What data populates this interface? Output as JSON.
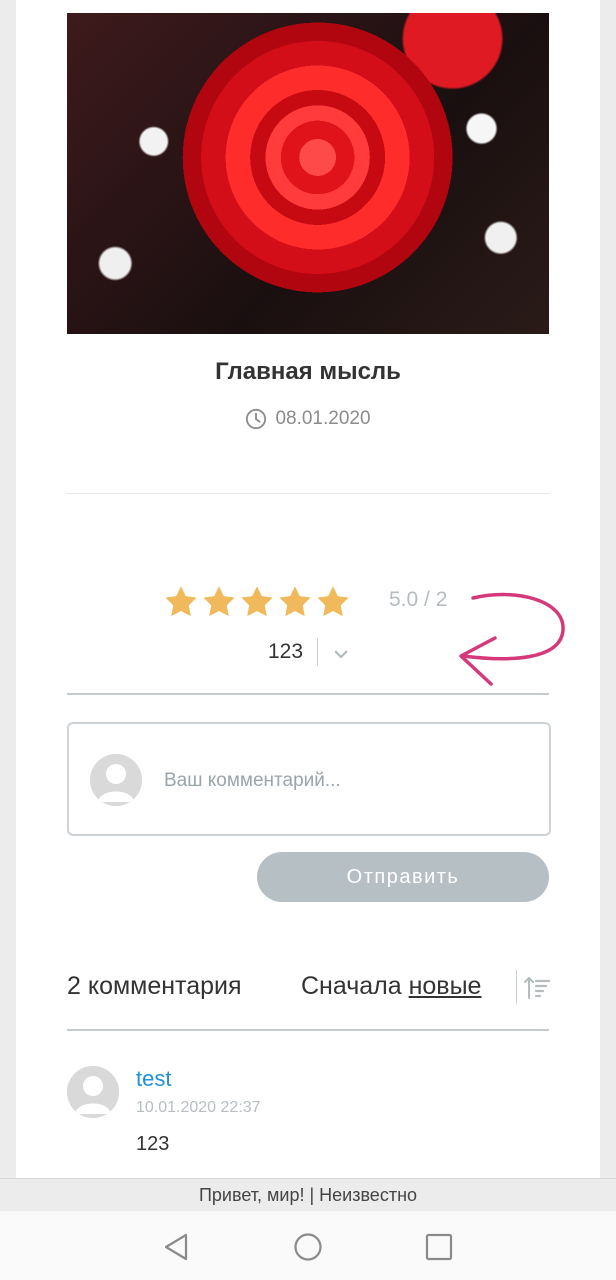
{
  "post": {
    "title": "Главная мысль",
    "date": "08.01.2020"
  },
  "rating": {
    "stars": 5,
    "max_stars": 5,
    "summary": "5.0 / 2",
    "vote_count": "123",
    "star_color": "#f0b95c"
  },
  "comment_form": {
    "placeholder": "Ваш комментарий...",
    "submit_label": "Отправить"
  },
  "comments_section": {
    "count_label": "2 комментария",
    "sort_prefix": "Сначала",
    "sort_link": "новые",
    "items": [
      {
        "author": "test",
        "time": "10.01.2020 22:37",
        "text": "123"
      }
    ]
  },
  "footer": {
    "text": "Привет, мир! | Неизвестно"
  },
  "colors": {
    "link": "#1f93d6",
    "button_bg": "#b6bfc3",
    "annotation": "#d6397a"
  },
  "icons": [
    "clock-icon",
    "star-icon",
    "chevron-down-icon",
    "sort-icon",
    "user-avatar-icon",
    "back-icon",
    "home-icon",
    "recents-icon"
  ]
}
